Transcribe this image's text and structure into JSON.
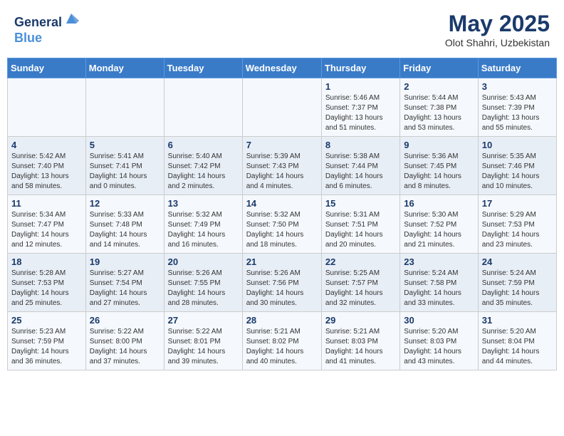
{
  "header": {
    "logo_line1": "General",
    "logo_line2": "Blue",
    "month": "May 2025",
    "location": "Olot Shahri, Uzbekistan"
  },
  "days_of_week": [
    "Sunday",
    "Monday",
    "Tuesday",
    "Wednesday",
    "Thursday",
    "Friday",
    "Saturday"
  ],
  "weeks": [
    [
      {
        "day": "",
        "info": ""
      },
      {
        "day": "",
        "info": ""
      },
      {
        "day": "",
        "info": ""
      },
      {
        "day": "",
        "info": ""
      },
      {
        "day": "1",
        "info": "Sunrise: 5:46 AM\nSunset: 7:37 PM\nDaylight: 13 hours\nand 51 minutes."
      },
      {
        "day": "2",
        "info": "Sunrise: 5:44 AM\nSunset: 7:38 PM\nDaylight: 13 hours\nand 53 minutes."
      },
      {
        "day": "3",
        "info": "Sunrise: 5:43 AM\nSunset: 7:39 PM\nDaylight: 13 hours\nand 55 minutes."
      }
    ],
    [
      {
        "day": "4",
        "info": "Sunrise: 5:42 AM\nSunset: 7:40 PM\nDaylight: 13 hours\nand 58 minutes."
      },
      {
        "day": "5",
        "info": "Sunrise: 5:41 AM\nSunset: 7:41 PM\nDaylight: 14 hours\nand 0 minutes."
      },
      {
        "day": "6",
        "info": "Sunrise: 5:40 AM\nSunset: 7:42 PM\nDaylight: 14 hours\nand 2 minutes."
      },
      {
        "day": "7",
        "info": "Sunrise: 5:39 AM\nSunset: 7:43 PM\nDaylight: 14 hours\nand 4 minutes."
      },
      {
        "day": "8",
        "info": "Sunrise: 5:38 AM\nSunset: 7:44 PM\nDaylight: 14 hours\nand 6 minutes."
      },
      {
        "day": "9",
        "info": "Sunrise: 5:36 AM\nSunset: 7:45 PM\nDaylight: 14 hours\nand 8 minutes."
      },
      {
        "day": "10",
        "info": "Sunrise: 5:35 AM\nSunset: 7:46 PM\nDaylight: 14 hours\nand 10 minutes."
      }
    ],
    [
      {
        "day": "11",
        "info": "Sunrise: 5:34 AM\nSunset: 7:47 PM\nDaylight: 14 hours\nand 12 minutes."
      },
      {
        "day": "12",
        "info": "Sunrise: 5:33 AM\nSunset: 7:48 PM\nDaylight: 14 hours\nand 14 minutes."
      },
      {
        "day": "13",
        "info": "Sunrise: 5:32 AM\nSunset: 7:49 PM\nDaylight: 14 hours\nand 16 minutes."
      },
      {
        "day": "14",
        "info": "Sunrise: 5:32 AM\nSunset: 7:50 PM\nDaylight: 14 hours\nand 18 minutes."
      },
      {
        "day": "15",
        "info": "Sunrise: 5:31 AM\nSunset: 7:51 PM\nDaylight: 14 hours\nand 20 minutes."
      },
      {
        "day": "16",
        "info": "Sunrise: 5:30 AM\nSunset: 7:52 PM\nDaylight: 14 hours\nand 21 minutes."
      },
      {
        "day": "17",
        "info": "Sunrise: 5:29 AM\nSunset: 7:53 PM\nDaylight: 14 hours\nand 23 minutes."
      }
    ],
    [
      {
        "day": "18",
        "info": "Sunrise: 5:28 AM\nSunset: 7:53 PM\nDaylight: 14 hours\nand 25 minutes."
      },
      {
        "day": "19",
        "info": "Sunrise: 5:27 AM\nSunset: 7:54 PM\nDaylight: 14 hours\nand 27 minutes."
      },
      {
        "day": "20",
        "info": "Sunrise: 5:26 AM\nSunset: 7:55 PM\nDaylight: 14 hours\nand 28 minutes."
      },
      {
        "day": "21",
        "info": "Sunrise: 5:26 AM\nSunset: 7:56 PM\nDaylight: 14 hours\nand 30 minutes."
      },
      {
        "day": "22",
        "info": "Sunrise: 5:25 AM\nSunset: 7:57 PM\nDaylight: 14 hours\nand 32 minutes."
      },
      {
        "day": "23",
        "info": "Sunrise: 5:24 AM\nSunset: 7:58 PM\nDaylight: 14 hours\nand 33 minutes."
      },
      {
        "day": "24",
        "info": "Sunrise: 5:24 AM\nSunset: 7:59 PM\nDaylight: 14 hours\nand 35 minutes."
      }
    ],
    [
      {
        "day": "25",
        "info": "Sunrise: 5:23 AM\nSunset: 7:59 PM\nDaylight: 14 hours\nand 36 minutes."
      },
      {
        "day": "26",
        "info": "Sunrise: 5:22 AM\nSunset: 8:00 PM\nDaylight: 14 hours\nand 37 minutes."
      },
      {
        "day": "27",
        "info": "Sunrise: 5:22 AM\nSunset: 8:01 PM\nDaylight: 14 hours\nand 39 minutes."
      },
      {
        "day": "28",
        "info": "Sunrise: 5:21 AM\nSunset: 8:02 PM\nDaylight: 14 hours\nand 40 minutes."
      },
      {
        "day": "29",
        "info": "Sunrise: 5:21 AM\nSunset: 8:03 PM\nDaylight: 14 hours\nand 41 minutes."
      },
      {
        "day": "30",
        "info": "Sunrise: 5:20 AM\nSunset: 8:03 PM\nDaylight: 14 hours\nand 43 minutes."
      },
      {
        "day": "31",
        "info": "Sunrise: 5:20 AM\nSunset: 8:04 PM\nDaylight: 14 hours\nand 44 minutes."
      }
    ]
  ]
}
